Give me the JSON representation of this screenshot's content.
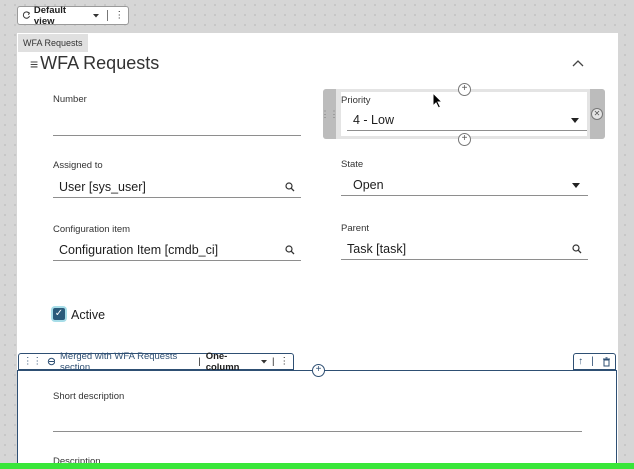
{
  "toolbar": {
    "view_label": "Default view",
    "more": "⋮"
  },
  "section_tag": "WFA Requests",
  "form": {
    "title": "WFA Requests",
    "fields": {
      "number": {
        "label": "Number",
        "value": ""
      },
      "priority": {
        "label": "Priority",
        "value": "4 - Low"
      },
      "assigned_to": {
        "label": "Assigned to",
        "value": "User [sys_user]"
      },
      "state": {
        "label": "State",
        "value": "Open"
      },
      "configuration_item": {
        "label": "Configuration item",
        "value": "Configuration Item [cmdb_ci]"
      },
      "parent": {
        "label": "Parent",
        "value": "Task [task]"
      },
      "active": {
        "label": "Active",
        "checked": true
      }
    }
  },
  "section2": {
    "merged_label": "Merged with WFA Requests section",
    "layout": "One-column",
    "short_description_label": "Short description",
    "description_label": "Description"
  }
}
